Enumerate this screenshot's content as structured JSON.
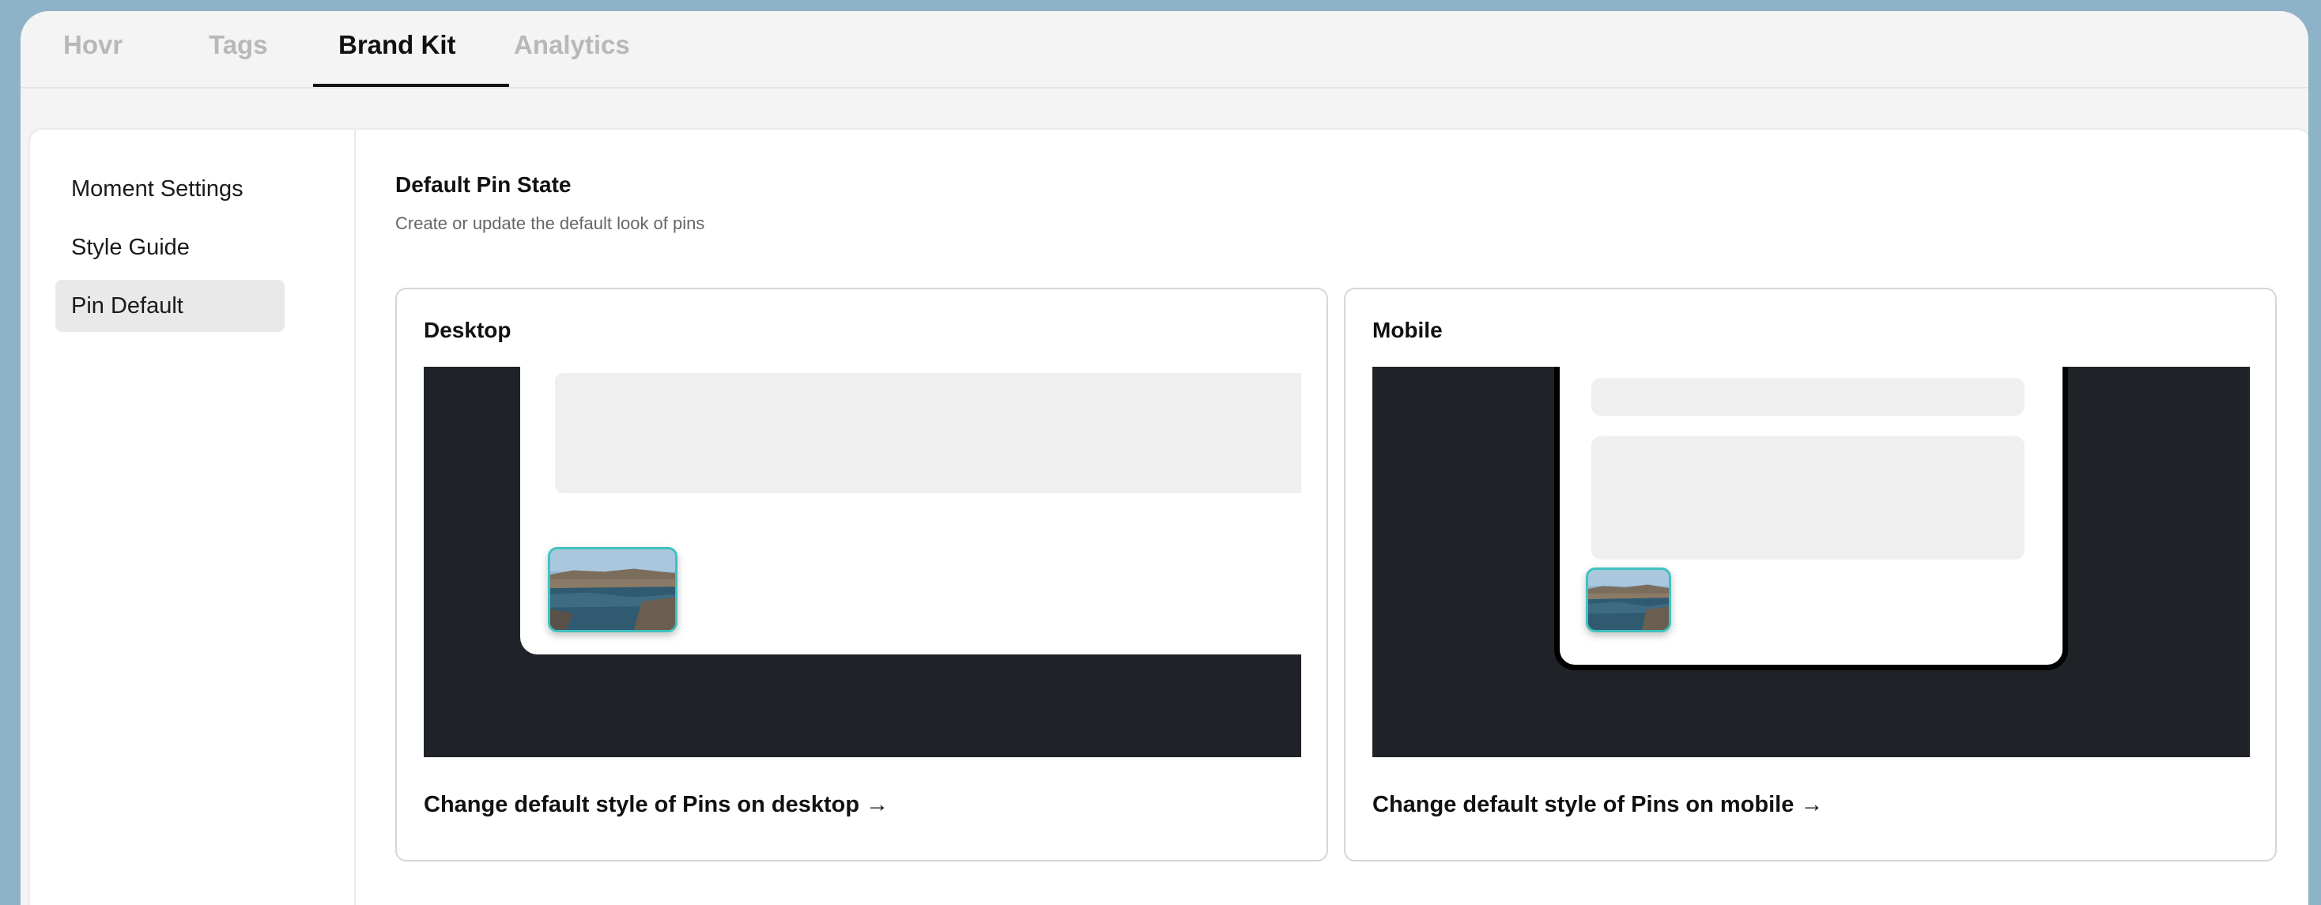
{
  "tabs": [
    {
      "label": "Hovr"
    },
    {
      "label": "Tags"
    },
    {
      "label": "Brand Kit",
      "active": true
    },
    {
      "label": "Analytics"
    }
  ],
  "sidebar": {
    "items": [
      {
        "label": "Moment Settings"
      },
      {
        "label": "Style Guide"
      },
      {
        "label": "Pin Default",
        "active": true
      }
    ]
  },
  "section": {
    "title": "Default Pin State",
    "subtitle": "Create or update the default look of pins"
  },
  "cards": {
    "desktop": {
      "title": "Desktop",
      "link": "Change default style of Pins on desktop",
      "arrow": "→"
    },
    "mobile": {
      "title": "Mobile",
      "link": "Change default style of Pins on mobile",
      "arrow": "→"
    }
  },
  "colors": {
    "background": "#8eb2c8",
    "preview_dark": "#1f2328",
    "pin_border": "#3ec2c0"
  },
  "icons": {
    "pin_thumbnail": "river-city-photo",
    "link_arrow": "arrow-right-icon"
  }
}
